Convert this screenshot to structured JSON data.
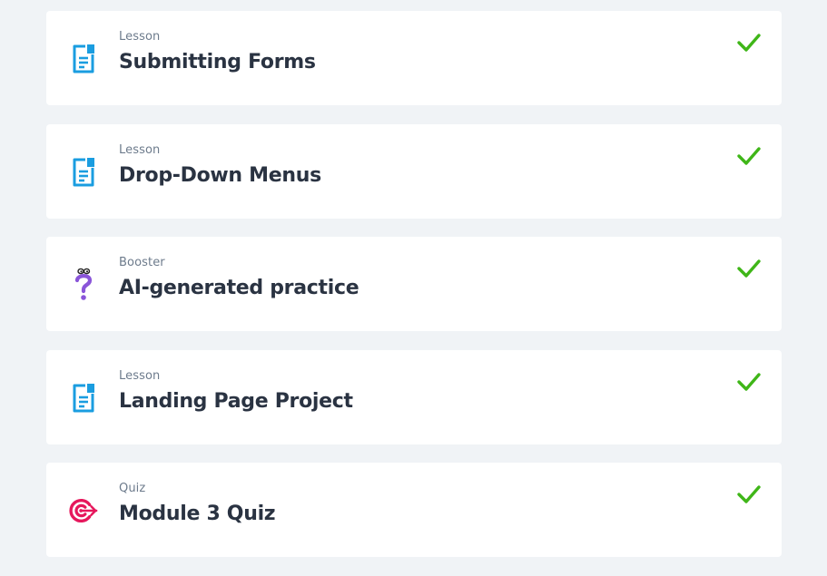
{
  "items": [
    {
      "kind": "Lesson",
      "title": "Submitting Forms",
      "icon": "lesson-document-icon",
      "status": "completed"
    },
    {
      "kind": "Lesson",
      "title": "Drop-Down Menus",
      "icon": "lesson-document-icon",
      "status": "completed"
    },
    {
      "kind": "Booster",
      "title": "AI-generated practice",
      "icon": "question-mark-icon",
      "status": "completed"
    },
    {
      "kind": "Lesson",
      "title": "Landing Page Project",
      "icon": "lesson-document-icon",
      "status": "completed"
    },
    {
      "kind": "Quiz",
      "title": "Module 3 Quiz",
      "icon": "target-icon",
      "status": "completed"
    }
  ],
  "colors": {
    "page_background": "#f0f3f6",
    "card_background": "#ffffff",
    "lesson_icon": "#1a9de0",
    "booster_icon": "#8a55d9",
    "quiz_icon": "#e6175c",
    "check": "#3fb618",
    "kind_text": "#6d7b8c",
    "title_text": "#2a3342"
  }
}
